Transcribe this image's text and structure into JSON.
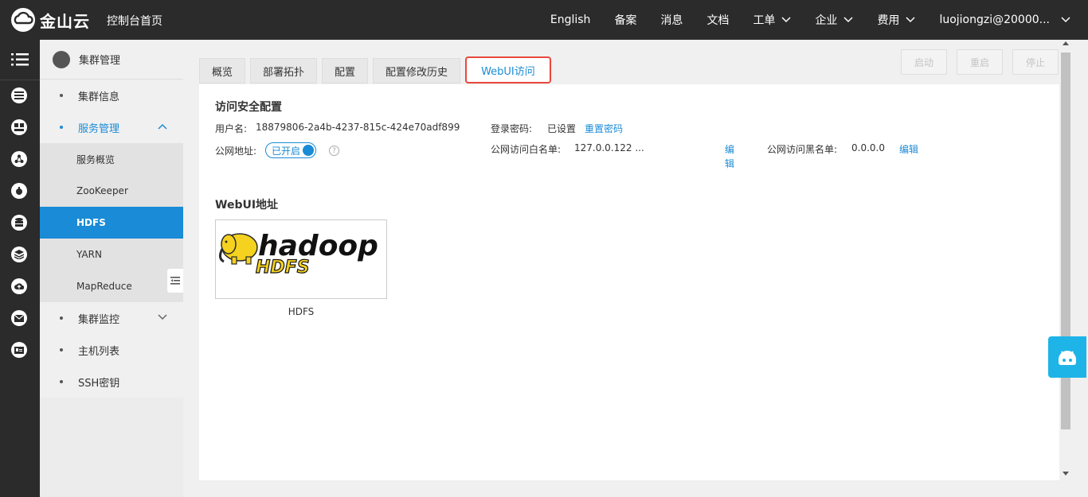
{
  "header": {
    "logo_text": "金山云",
    "home_link": "控制台首页",
    "nav": [
      {
        "label": "English",
        "dropdown": false
      },
      {
        "label": "备案",
        "dropdown": false
      },
      {
        "label": "消息",
        "dropdown": false
      },
      {
        "label": "文档",
        "dropdown": false
      },
      {
        "label": "工单",
        "dropdown": true
      },
      {
        "label": "企业",
        "dropdown": true
      },
      {
        "label": "费用",
        "dropdown": true
      },
      {
        "label": "luojiongzi@20000...",
        "dropdown": true
      }
    ]
  },
  "rail": {
    "icons": [
      "menu-icon",
      "list-icon",
      "gamepad-icon",
      "network-icon",
      "bug-icon",
      "database-icon",
      "layers-icon",
      "cloud-upload-icon",
      "mail-icon",
      "id-card-icon"
    ]
  },
  "sidebar": {
    "header": "集群管理",
    "items": [
      {
        "label": "集群信息"
      },
      {
        "label": "服务管理"
      },
      {
        "label": "集群监控"
      },
      {
        "label": "主机列表"
      },
      {
        "label": "SSH密钥"
      }
    ],
    "sub_items": [
      {
        "label": "服务概览"
      },
      {
        "label": "ZooKeeper"
      },
      {
        "label": "HDFS"
      },
      {
        "label": "YARN"
      },
      {
        "label": "MapReduce"
      }
    ]
  },
  "tabs": [
    {
      "label": "概览"
    },
    {
      "label": "部署拓扑"
    },
    {
      "label": "配置"
    },
    {
      "label": "配置修改历史"
    },
    {
      "label": "WebUI访问"
    }
  ],
  "actions": {
    "start": "启动",
    "restart": "重启",
    "stop": "停止"
  },
  "security": {
    "title": "访问安全配置",
    "username_label": "用户名:",
    "username_value": "18879806-2a4b-4237-815c-424e70adf899",
    "password_label": "登录密码:",
    "password_value": "已设置",
    "reset_password": "重置密码",
    "public_addr_label": "公网地址:",
    "public_addr_toggle": "已开启",
    "help": "?",
    "whitelist_label": "公网访问白名单:",
    "whitelist_value": "127.0.0.122 ...",
    "whitelist_edit_1": "编",
    "whitelist_edit_2": "辑",
    "blacklist_label": "公网访问黑名单:",
    "blacklist_value": "0.0.0.0",
    "blacklist_edit": "编辑"
  },
  "webui": {
    "title": "WebUI地址",
    "card_logo_main": "hadoop",
    "card_logo_sub": "HDFS",
    "card_caption": "HDFS"
  },
  "colors": {
    "accent": "#1a8bd6",
    "topbar": "#2b2b2b",
    "tab_highlight": "#e8473e",
    "float_help": "#1eb4e8",
    "hadoop_yellow": "#f5d21f"
  }
}
